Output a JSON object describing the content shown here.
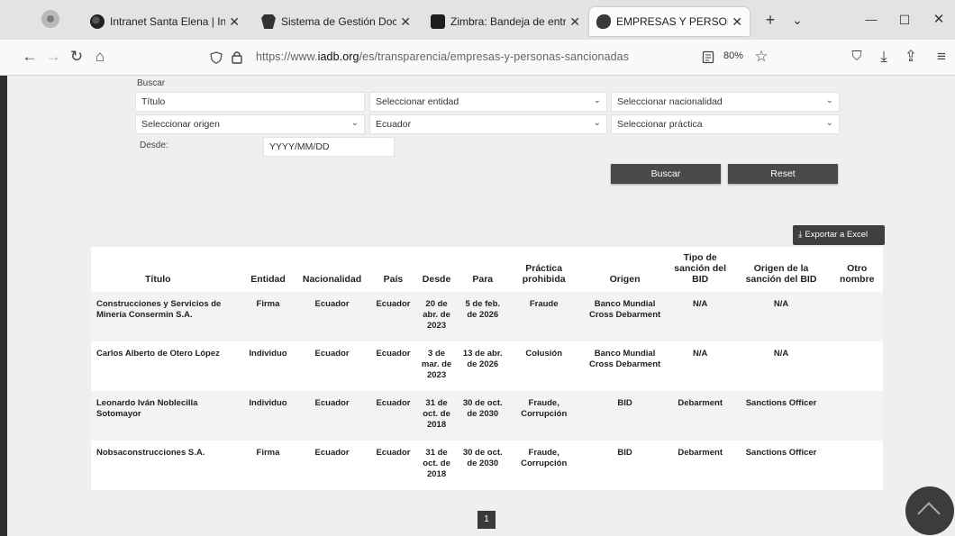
{
  "browser": {
    "tabs": [
      {
        "title": "Intranet Santa Elena | Intran",
        "icon": "globe-icon"
      },
      {
        "title": "Sistema de Gestión Docum",
        "icon": "document-icon"
      },
      {
        "title": "Zimbra: Bandeja de entrada",
        "icon": "zimbra-icon"
      },
      {
        "title": "EMPRESAS Y PERSONAS SA",
        "icon": "iadb-icon"
      }
    ],
    "tab_close": "✕",
    "new_tab": "+",
    "tab_list": "⌄",
    "minimize": "—",
    "maximize": "☐",
    "close": "✕",
    "back": "←",
    "forward": "→",
    "reload": "↻",
    "home": "⌂",
    "url_prefix": "https://www.",
    "url_domain": "iadb.org",
    "url_path": "/es/transparencia/empresas-y-personas-sancionadas",
    "zoom": "80%",
    "star": "☆",
    "pocket": "⛉",
    "download": "⤓",
    "extensions": "⇪",
    "menu": "≡"
  },
  "form": {
    "buscar_label": "Buscar",
    "titulo_placeholder": "Título",
    "entidad": "Seleccionar entidad",
    "nacionalidad": "Seleccionar nacionalidad",
    "origen": "Seleccionar origen",
    "pais": "Ecuador",
    "practica": "Seleccionar práctica",
    "desde_label": "Desde:",
    "desde_placeholder": "YYYY/MM/DD",
    "caret": "⌄"
  },
  "actions": {
    "buscar": "Buscar",
    "reset": "Reset",
    "export": "Exportar a Excel",
    "export_icon": "⤓"
  },
  "table": {
    "headers": [
      "Título",
      "Entidad",
      "Nacionalidad",
      "País",
      "Desde",
      "Para",
      "Práctica prohibida",
      "Origen",
      "Tipo de sanción del BID",
      "Origen de la sanción del BID",
      "Otro nombre"
    ],
    "rows": [
      [
        "Construcciones y Servicios de Minería Consermin S.A.",
        "Firma",
        "Ecuador",
        "Ecuador",
        "20 de abr. de 2023",
        "5 de feb. de 2026",
        "Fraude",
        "Banco Mundial Cross Debarment",
        "N/A",
        "N/A",
        ""
      ],
      [
        "Carlos Alberto de Otero López",
        "Individuo",
        "Ecuador",
        "Ecuador",
        "3 de mar. de 2023",
        "13 de abr. de 2026",
        "Colusión",
        "Banco Mundial Cross Debarment",
        "N/A",
        "N/A",
        ""
      ],
      [
        "Leonardo Iván Noblecilla Sotomayor",
        "Individuo",
        "Ecuador",
        "Ecuador",
        "31 de oct. de 2018",
        "30 de oct. de 2030",
        "Fraude, Corrupción",
        "BID",
        "Debarment",
        "Sanctions Officer",
        ""
      ],
      [
        "Nobsaconstrucciones S.A.",
        "Firma",
        "Ecuador",
        "Ecuador",
        "31 de oct. de 2018",
        "30 de oct. de 2030",
        "Fraude, Corrupción",
        "BID",
        "Debarment",
        "Sanctions Officer",
        ""
      ]
    ]
  },
  "pagination": {
    "current": "1"
  }
}
